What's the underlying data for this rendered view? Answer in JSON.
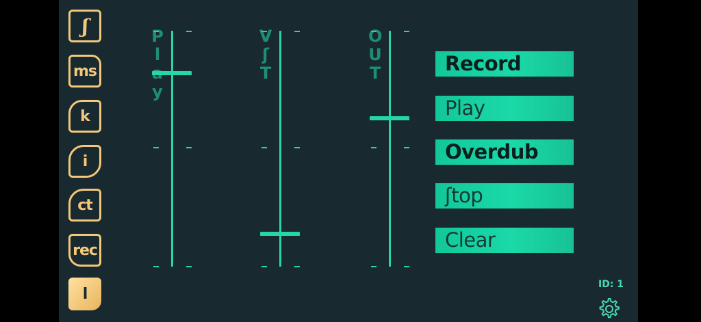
{
  "sidebar": {
    "items": [
      {
        "label": "ʃ",
        "name": "sidebar-item-s"
      },
      {
        "label": "ms",
        "name": "sidebar-item-ms"
      },
      {
        "label": "k",
        "name": "sidebar-item-k"
      },
      {
        "label": "i",
        "name": "sidebar-item-i"
      },
      {
        "label": "ct",
        "name": "sidebar-item-ct"
      },
      {
        "label": "rec",
        "name": "sidebar-item-rec"
      },
      {
        "label": "l",
        "name": "sidebar-item-l"
      }
    ],
    "active_index": 6
  },
  "faders": [
    {
      "label": "Play",
      "letters": [
        "P",
        "l",
        "a",
        "y"
      ],
      "value": 0.82
    },
    {
      "label": "VST",
      "letters": [
        "V",
        "ʃ",
        "T"
      ],
      "value": 0.14
    },
    {
      "label": "OUT",
      "letters": [
        "O",
        "U",
        "T"
      ],
      "value": 0.63
    }
  ],
  "actions": {
    "record": "Record",
    "play": "Play",
    "overdub": "Overdub",
    "stop": "ʃtop",
    "clear": "Clear"
  },
  "status": {
    "id": "ID: 1"
  },
  "colors": {
    "accent": "#26d6a4",
    "sidebar": "#f4c77a",
    "background": "#182a30"
  }
}
